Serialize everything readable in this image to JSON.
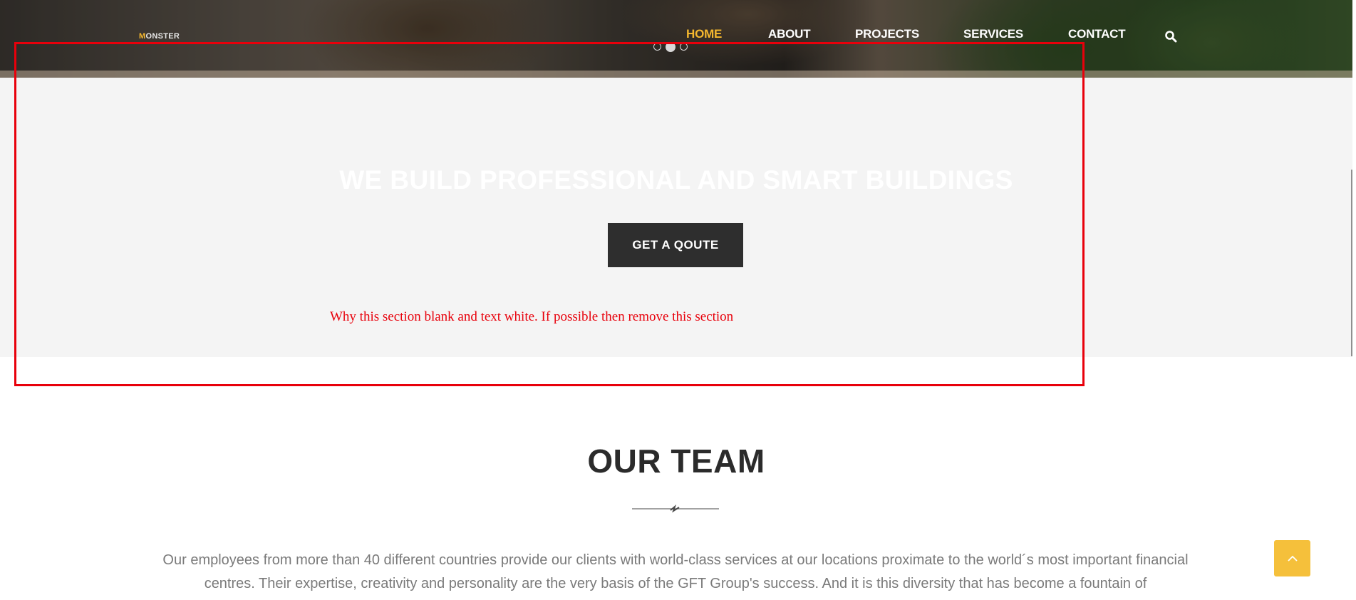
{
  "header": {
    "logo": {
      "accent": "M",
      "rest": "ONSTER"
    },
    "nav": [
      {
        "label": "HOME",
        "active": true
      },
      {
        "label": "ABOUT"
      },
      {
        "label": "PROJECTS"
      },
      {
        "label": "SERVICES"
      },
      {
        "label": "CONTACT"
      }
    ],
    "search_icon": "search-icon",
    "slider": {
      "count": 3,
      "active_index": 1
    }
  },
  "banner": {
    "title": "WE BUILD PROFESSIONAL AND SMART BUILDINGS",
    "button_label": "GET A QOUTE",
    "note": "Why this section blank and text white. If possible then remove this section"
  },
  "team": {
    "title": "OUR TEAM",
    "description": "Our employees from more than 40 different countries provide our clients with world-class services at our locations proximate to the world´s most important financial centres. Their expertise, creativity and personality are the very basis of the GFT Group's success. And it is this diversity that has become a fountain of"
  },
  "back_to_top_icon": "chevron-up-icon",
  "colors": {
    "accent": "#f5b82e",
    "annotation": "#e8000b",
    "button_dark": "#2e2e2e",
    "banner_bg": "#f4f4f4"
  }
}
